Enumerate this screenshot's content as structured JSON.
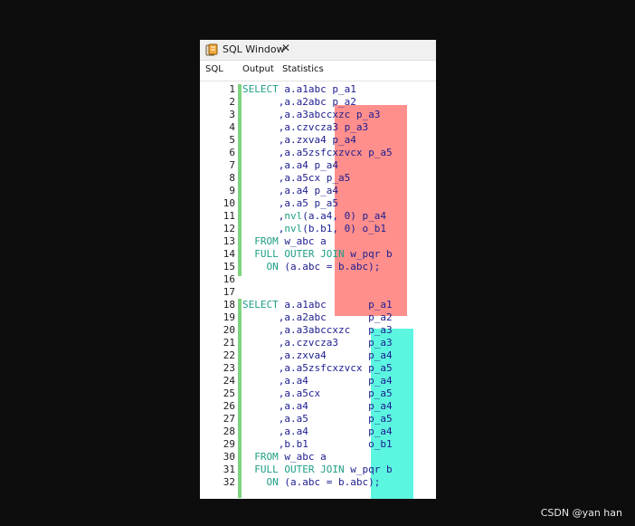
{
  "window": {
    "title": "SQL Window",
    "close_glyph": "✕",
    "icon": "sql-window-icon"
  },
  "tabs": [
    {
      "label": "SQL"
    },
    {
      "label": "Output"
    },
    {
      "label": "Statistics"
    }
  ],
  "colors": {
    "highlight_red": "#ff8f8c",
    "highlight_cyan": "#5cf5e0",
    "change_bar": "#7fd47f",
    "keyword": "#1e9e86",
    "identifier": "#1d1d8f"
  },
  "editor": {
    "lines": [
      {
        "n": "1",
        "text": "SELECT a.a1abc p_a1"
      },
      {
        "n": "2",
        "text": "      ,a.a2abc p_a2"
      },
      {
        "n": "3",
        "text": "      ,a.a3abccxzc p_a3"
      },
      {
        "n": "4",
        "text": "      ,a.czvcza3 p_a3"
      },
      {
        "n": "5",
        "text": "      ,a.zxva4 p_a4"
      },
      {
        "n": "6",
        "text": "      ,a.a5zsfcxzvcx p_a5"
      },
      {
        "n": "7",
        "text": "      ,a.a4 p_a4"
      },
      {
        "n": "8",
        "text": "      ,a.a5cx p_a5"
      },
      {
        "n": "9",
        "text": "      ,a.a4 p_a4"
      },
      {
        "n": "10",
        "text": "      ,a.a5 p_a5"
      },
      {
        "n": "11",
        "text": "      ,nvl(a.a4, 0) p_a4"
      },
      {
        "n": "12",
        "text": "      ,nvl(b.b1, 0) o_b1"
      },
      {
        "n": "13",
        "text": "  FROM w_abc a"
      },
      {
        "n": "14",
        "text": "  FULL OUTER JOIN w_pqr b"
      },
      {
        "n": "15",
        "text": "    ON (a.abc = b.abc);"
      },
      {
        "n": "16",
        "text": ""
      },
      {
        "n": "17",
        "text": ""
      },
      {
        "n": "18",
        "text": "SELECT a.a1abc       p_a1"
      },
      {
        "n": "19",
        "text": "      ,a.a2abc       p_a2"
      },
      {
        "n": "20",
        "text": "      ,a.a3abccxzc   p_a3"
      },
      {
        "n": "21",
        "text": "      ,a.czvcza3     p_a3"
      },
      {
        "n": "22",
        "text": "      ,a.zxva4       p_a4"
      },
      {
        "n": "23",
        "text": "      ,a.a5zsfcxzvcx p_a5"
      },
      {
        "n": "24",
        "text": "      ,a.a4          p_a4"
      },
      {
        "n": "25",
        "text": "      ,a.a5cx        p_a5"
      },
      {
        "n": "26",
        "text": "      ,a.a4          p_a4"
      },
      {
        "n": "27",
        "text": "      ,a.a5          p_a5"
      },
      {
        "n": "28",
        "text": "      ,a.a4          p_a4"
      },
      {
        "n": "29",
        "text": "      ,b.b1          o_b1"
      },
      {
        "n": "30",
        "text": "  FROM w_abc a"
      },
      {
        "n": "31",
        "text": "  FULL OUTER JOIN w_pqr b"
      },
      {
        "n": "32",
        "text": "    ON (a.abc = b.abc);"
      }
    ]
  },
  "watermark": "CSDN @yan han"
}
